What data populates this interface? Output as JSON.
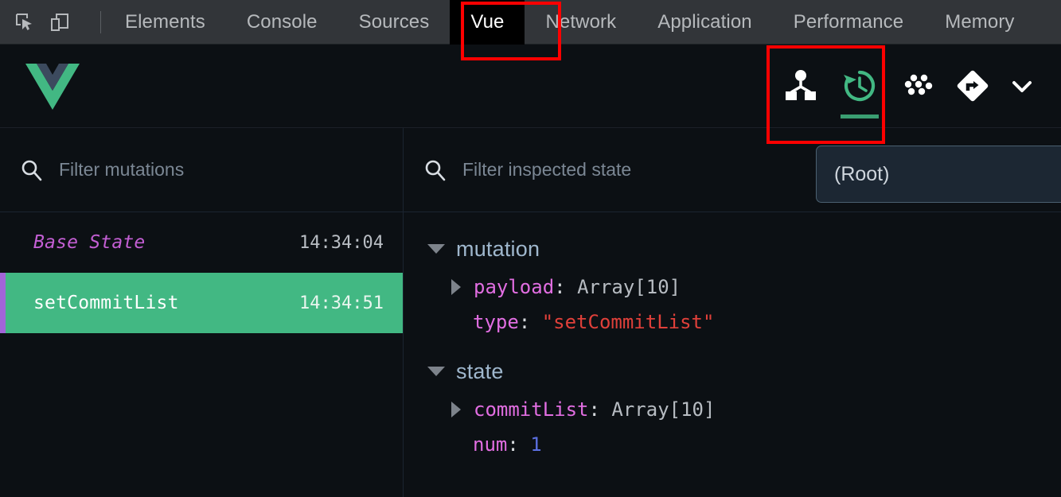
{
  "devtools": {
    "tools": [
      {
        "name": "inspect-element-icon",
        "label": "Inspect element"
      },
      {
        "name": "device-toolbar-icon",
        "label": "Toggle device toolbar"
      }
    ],
    "tabs": [
      {
        "label": "Elements",
        "active": false
      },
      {
        "label": "Console",
        "active": false
      },
      {
        "label": "Sources",
        "active": false
      },
      {
        "label": "Vue",
        "active": true
      },
      {
        "label": "Network",
        "active": false
      },
      {
        "label": "Application",
        "active": false
      },
      {
        "label": "Performance",
        "active": false
      },
      {
        "label": "Memory",
        "active": false
      }
    ]
  },
  "vue_toolbar": {
    "logo_name": "vue-logo",
    "buttons": [
      {
        "name": "components-tab-icon",
        "label": "Components",
        "active": false
      },
      {
        "name": "history-tab-icon",
        "label": "Vuex",
        "active": true
      },
      {
        "name": "events-tab-icon",
        "label": "Events",
        "active": false
      },
      {
        "name": "routing-tab-icon",
        "label": "Routing",
        "active": false
      },
      {
        "name": "more-tabs-chevron-icon",
        "label": "More",
        "active": false
      }
    ]
  },
  "left_pane": {
    "filter": {
      "placeholder": "Filter mutations",
      "value": ""
    },
    "mutations": [
      {
        "name": "Base State",
        "time": "14:34:04",
        "base": true,
        "active": false
      },
      {
        "name": "setCommitList",
        "time": "14:34:51",
        "base": false,
        "active": true
      }
    ]
  },
  "right_pane": {
    "filter": {
      "placeholder": "Filter inspected state",
      "value": ""
    },
    "root_selector": {
      "label": "(Root)"
    },
    "groups": [
      {
        "title": "mutation",
        "rows": [
          {
            "key": "payload",
            "value": "Array[10]",
            "value_type": "gray",
            "expandable": true
          },
          {
            "key": "type",
            "value": "\"setCommitList\"",
            "value_type": "string",
            "expandable": false
          }
        ]
      },
      {
        "title": "state",
        "rows": [
          {
            "key": "commitList",
            "value": "Array[10]",
            "value_type": "gray",
            "expandable": true
          },
          {
            "key": "num",
            "value": "1",
            "value_type": "number",
            "expandable": false
          }
        ]
      }
    ]
  },
  "annotations": [
    {
      "name": "annotation-box-vue-tab",
      "color": "#fe0000"
    },
    {
      "name": "annotation-box-history-button",
      "color": "#fe0000"
    }
  ],
  "colors": {
    "vue_green": "#42b883",
    "accent_purple": "#a265d8",
    "annotation_red": "#fe0000"
  }
}
